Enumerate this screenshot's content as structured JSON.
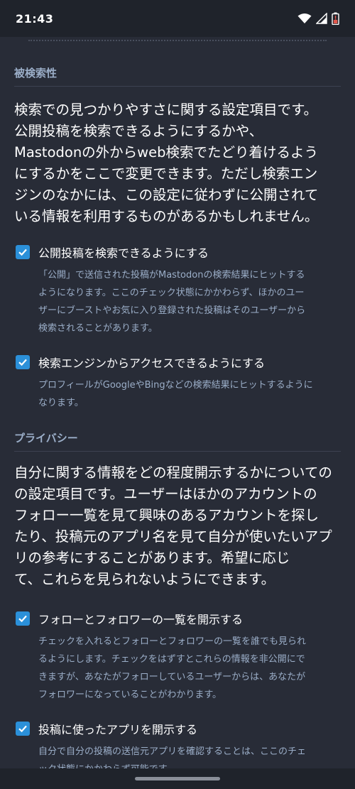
{
  "status_bar": {
    "time": "21:43",
    "icons": [
      "wifi-icon",
      "cellular-signal-icon",
      "battery-low-icon"
    ]
  },
  "colors": {
    "background": "#282c37",
    "status_bar": "#1f232b",
    "checkbox": "#2b90d9",
    "heading": "#9baec8",
    "text": "#ffffff",
    "hint": "#9baec8"
  },
  "discoverability": {
    "heading": "被検索性",
    "lead": [
      "検索での見つかりやすさに関する設定項目です。",
      "公開投稿を検索できるようにするかや、",
      "Mastodonの外からweb検索でたどり着けるよう",
      "にするかをここで変更できます。ただし検索エン",
      "ジンのなかには、この設定に従わずに公開されて",
      "いる情報を利用するものがあるかもしれません。"
    ],
    "options": [
      {
        "label": "公開投稿を検索できるようにする",
        "checked": true,
        "hint": [
          "「公開」で送信された投稿がMastodonの検索結果にヒットする",
          "ようになります。ここのチェック状態にかかわらず、ほかのユー",
          "ザーにブーストやお気に入り登録された投稿はそのユーザーから",
          "検索されることがあります。"
        ]
      },
      {
        "label": "検索エンジンからアクセスできるようにする",
        "checked": true,
        "hint": [
          "プロフィールがGoogleやBingなどの検索結果にヒットするように",
          "なります。"
        ]
      }
    ]
  },
  "privacy": {
    "heading": "プライバシー",
    "lead": [
      "自分に関する情報をどの程度開示するかについての",
      "の設定項目です。ユーザーはほかのアカウントの",
      "フォロー一覧を見て興味のあるアカウントを探し",
      "たり、投稿元のアプリ名を見て自分が使いたいアプ",
      "リの参考にすることがあります。希望に応じ",
      "て、これらを見られないようにできます。"
    ],
    "options": [
      {
        "label": "フォローとフォロワーの一覧を開示する",
        "checked": true,
        "hint": [
          "チェックを入れるとフォローとフォロワーの一覧を誰でも見られ",
          "るようにします。チェックをはずすとこれらの情報を非公開にで",
          "きますが、あなたがフォローしているユーザーからは、あなたが",
          "フォロワーになっていることがわかります。"
        ]
      },
      {
        "label": "投稿に使ったアプリを開示する",
        "checked": true,
        "hint": [
          "自分で自分の投稿の送信元アプリを確認することは、ここのチェ",
          "ック状態にかかわらず可能です。"
        ]
      }
    ]
  }
}
